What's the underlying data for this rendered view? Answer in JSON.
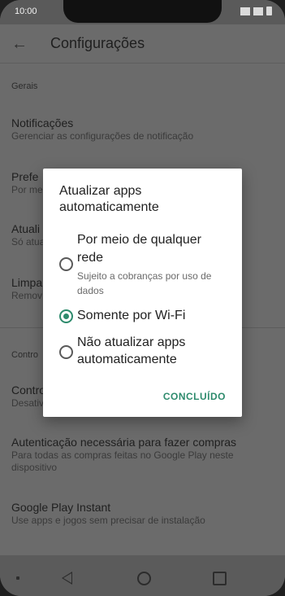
{
  "status_bar": {
    "time": "10:00"
  },
  "app_bar": {
    "title": "Configurações",
    "back_icon": "arrow-left-icon"
  },
  "settings": {
    "section_general": "Gerais",
    "items": [
      {
        "title": "Notificações",
        "subtitle": "Gerenciar as configurações de notificação"
      },
      {
        "title": "Prefe",
        "subtitle": "Por me"
      },
      {
        "title": "Atuali",
        "subtitle": "Só atua"
      },
      {
        "title": "Limpa",
        "subtitle": "Remov"
      }
    ],
    "section_controls": "Contro",
    "controls_items": [
      {
        "title": "Contro",
        "subtitle": "Desativ"
      },
      {
        "title": "Autenticação necessária para fazer compras",
        "subtitle_line1": "Para todas as compras feitas no Google Play neste",
        "subtitle_line2": "dispositivo"
      },
      {
        "title": "Google Play Instant",
        "subtitle": "Use apps e jogos sem precisar de instalação"
      }
    ]
  },
  "dialog": {
    "title_line1": "Atualizar apps",
    "title_line2": "automaticamente",
    "options": [
      {
        "label_line1": "Por meio de qualquer",
        "label_line2": "rede",
        "sub_line1": "Sujeito a cobranças por uso de",
        "sub_line2": "dados",
        "selected": false
      },
      {
        "label_line1": "Somente por Wi-Fi",
        "selected": true
      },
      {
        "label_line1": "Não atualizar apps",
        "label_line2": "automaticamente",
        "selected": false
      }
    ],
    "done_label": "CONCLUÍDO",
    "accent": "#2e8b6d"
  },
  "nav_bar": {
    "icons": [
      "menu-dot-icon",
      "back-triangle-icon",
      "home-circle-icon",
      "recents-square-icon"
    ]
  }
}
